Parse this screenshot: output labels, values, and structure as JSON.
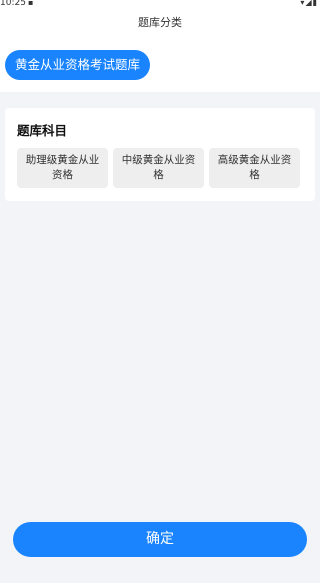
{
  "status_bar": {
    "time": "10:25",
    "notification_icon": "sim-card-icon",
    "signal_icons": "wifi-signal-battery-icons"
  },
  "header": {
    "title": "题库分类"
  },
  "category": {
    "selected_label": "黄金从业资格考试题库"
  },
  "subjects": {
    "title": "题库科目",
    "items": [
      {
        "label": "助理级黄金从业资格"
      },
      {
        "label": "中级黄金从业资格"
      },
      {
        "label": "高级黄金从业资格"
      }
    ]
  },
  "footer": {
    "confirm_label": "确定"
  },
  "colors": {
    "accent": "#1a84ff",
    "background": "#f2f4f7",
    "chip_bg": "#eeeeee"
  }
}
